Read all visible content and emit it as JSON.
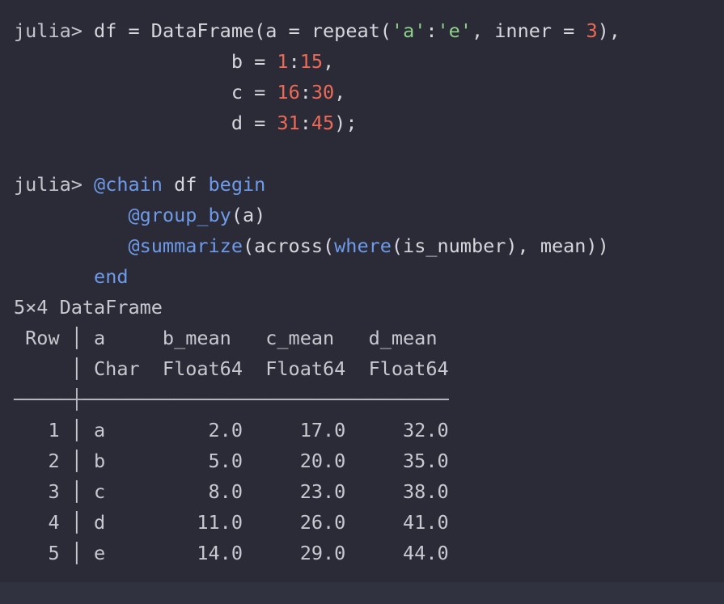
{
  "session": {
    "prompt": "julia> ",
    "cmd1": {
      "l1": {
        "var": "df",
        "eq": " = ",
        "fn": "DataFrame(",
        "arg_a": "a = repeat(",
        "q1": "'a'",
        "colon": ":",
        "q2": "'e'",
        "inner": ", inner = ",
        "n3": "3",
        "close": "),"
      },
      "l2": {
        "pad": "                   ",
        "name": "b = ",
        "start": "1",
        "colon": ":",
        "end": "15",
        "tail": ","
      },
      "l3": {
        "pad": "                   ",
        "name": "c = ",
        "start": "16",
        "colon": ":",
        "end": "30",
        "tail": ","
      },
      "l4": {
        "pad": "                   ",
        "name": "d = ",
        "start": "31",
        "colon": ":",
        "end": "45",
        "tail": ");"
      }
    },
    "cmd2": {
      "l1": {
        "chain": "@chain",
        "mid": " df ",
        "begin": "begin"
      },
      "l2": {
        "pad": "          ",
        "macro": "@group_by",
        "args": "(a)"
      },
      "l3": {
        "pad": "          ",
        "macro": "@summarize",
        "open": "(across(",
        "where": "where",
        "args": "(is_number), mean))"
      },
      "l4": {
        "pad": "       ",
        "end": "end"
      }
    }
  },
  "result": {
    "summary": "5×4 DataFrame",
    "header_names": " Row │ a     b_mean   c_mean   d_mean",
    "header_types": "     │ Char  Float64  Float64  Float64",
    "separator": "─────┼────────────────────────────────",
    "rows": [
      "   1 │ a         2.0     17.0     32.0",
      "   2 │ b         5.0     20.0     35.0",
      "   3 │ c         8.0     23.0     38.0",
      "   4 │ d        11.0     26.0     41.0",
      "   5 │ e        14.0     29.0     44.0"
    ]
  },
  "colors": {
    "background": "#2a2b37",
    "text": "#d6d6dc",
    "keyword": "#6f9ae8",
    "string": "#8fd08a",
    "number": "#ec6a56"
  }
}
